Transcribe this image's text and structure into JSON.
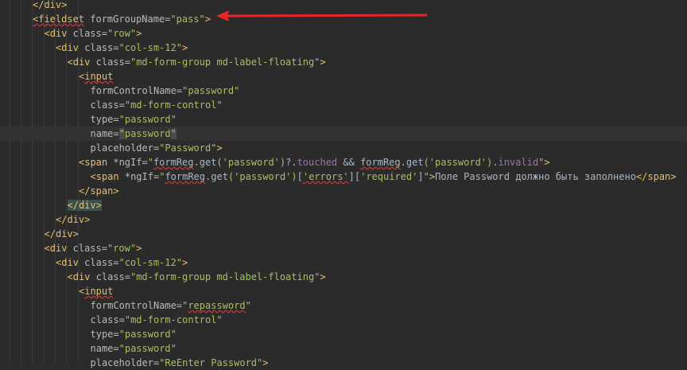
{
  "lines": [
    {
      "indent": 2,
      "tokens": [
        {
          "t": "</div>",
          "c": "tag"
        }
      ]
    },
    {
      "indent": 2,
      "tokens": [
        {
          "t": "<fieldset",
          "c": "tag",
          "sq": true
        },
        {
          "t": " formGroupName=",
          "c": "attr"
        },
        {
          "t": "\"pass\"",
          "c": "str"
        },
        {
          "t": ">",
          "c": "tag"
        }
      ]
    },
    {
      "indent": 3,
      "tokens": [
        {
          "t": "<div",
          "c": "tag"
        },
        {
          "t": " class=",
          "c": "attr"
        },
        {
          "t": "\"row\"",
          "c": "str"
        },
        {
          "t": ">",
          "c": "tag"
        }
      ]
    },
    {
      "indent": 4,
      "tokens": [
        {
          "t": "<div",
          "c": "tag"
        },
        {
          "t": " class=",
          "c": "attr"
        },
        {
          "t": "\"col-sm-12\"",
          "c": "str"
        },
        {
          "t": ">",
          "c": "tag"
        }
      ]
    },
    {
      "indent": 5,
      "tokens": [
        {
          "t": "<div",
          "c": "tag"
        },
        {
          "t": " class=",
          "c": "attr"
        },
        {
          "t": "\"md-form-group md-label-floating\"",
          "c": "str"
        },
        {
          "t": ">",
          "c": "tag"
        }
      ]
    },
    {
      "indent": 6,
      "tokens": [
        {
          "t": "<",
          "c": "tag"
        },
        {
          "t": "input",
          "c": "tag",
          "sq": true
        }
      ]
    },
    {
      "indent": 7,
      "tokens": [
        {
          "t": "formControlName=",
          "c": "attr"
        },
        {
          "t": "\"password\"",
          "c": "str"
        }
      ]
    },
    {
      "indent": 7,
      "tokens": [
        {
          "t": "class=",
          "c": "attr"
        },
        {
          "t": "\"md-form-control\"",
          "c": "str"
        }
      ]
    },
    {
      "indent": 7,
      "tokens": [
        {
          "t": "type=",
          "c": "attr"
        },
        {
          "t": "\"password\"",
          "c": "str"
        }
      ]
    },
    {
      "indent": 7,
      "current": true,
      "tokens": [
        {
          "t": "name=",
          "c": "attr"
        },
        {
          "t": "\"",
          "c": "str",
          "hl": "quote"
        },
        {
          "t": "password",
          "c": "str"
        },
        {
          "t": "\"",
          "c": "str",
          "hl": "quote"
        }
      ]
    },
    {
      "indent": 7,
      "tokens": [
        {
          "t": "placeholder=",
          "c": "attr"
        },
        {
          "t": "\"Password\"",
          "c": "str"
        },
        {
          "t": ">",
          "c": "tag"
        }
      ]
    },
    {
      "indent": 6,
      "tokens": [
        {
          "t": "<span",
          "c": "tag"
        },
        {
          "t": " *ngIf=",
          "c": "attr"
        },
        {
          "t": "\"",
          "c": "str"
        },
        {
          "t": "formReg",
          "c": "call",
          "sq": true
        },
        {
          "t": ".get",
          "c": "call"
        },
        {
          "t": "('password')",
          "c": "str"
        },
        {
          "t": "?.",
          "c": "call"
        },
        {
          "t": "touched",
          "c": "ident"
        },
        {
          "t": " && ",
          "c": "call"
        },
        {
          "t": "formReg",
          "c": "call",
          "sq": true
        },
        {
          "t": ".get",
          "c": "call"
        },
        {
          "t": "('password')",
          "c": "str"
        },
        {
          "t": ".",
          "c": "call"
        },
        {
          "t": "invalid",
          "c": "ident"
        },
        {
          "t": "\"",
          "c": "str"
        },
        {
          "t": ">",
          "c": "tag"
        }
      ]
    },
    {
      "indent": 7,
      "tokens": [
        {
          "t": "<span",
          "c": "tag"
        },
        {
          "t": " *ngIf=",
          "c": "attr"
        },
        {
          "t": "\"",
          "c": "str"
        },
        {
          "t": "formReg",
          "c": "call",
          "sq": true
        },
        {
          "t": ".get",
          "c": "call"
        },
        {
          "t": "('password')",
          "c": "str"
        },
        {
          "t": "[",
          "c": "call"
        },
        {
          "t": "'errors'",
          "c": "str",
          "sq": true
        },
        {
          "t": "][",
          "c": "call"
        },
        {
          "t": "'required'",
          "c": "str"
        },
        {
          "t": "]",
          "c": "call"
        },
        {
          "t": "\"",
          "c": "str"
        },
        {
          "t": ">",
          "c": "tag"
        },
        {
          "t": "Поле Password должно быть заполнено",
          "c": "text"
        },
        {
          "t": "</span>",
          "c": "tag"
        }
      ]
    },
    {
      "indent": 6,
      "tokens": [
        {
          "t": "</span>",
          "c": "tag"
        }
      ]
    },
    {
      "indent": 5,
      "tokens": [
        {
          "t": "</div>",
          "c": "tag",
          "hl": "tag"
        }
      ]
    },
    {
      "indent": 4,
      "tokens": [
        {
          "t": "</div>",
          "c": "tag"
        }
      ]
    },
    {
      "indent": 3,
      "tokens": [
        {
          "t": "</div>",
          "c": "tag"
        }
      ]
    },
    {
      "indent": 3,
      "tokens": [
        {
          "t": "<div",
          "c": "tag"
        },
        {
          "t": " class=",
          "c": "attr"
        },
        {
          "t": "\"row\"",
          "c": "str"
        },
        {
          "t": ">",
          "c": "tag"
        }
      ]
    },
    {
      "indent": 4,
      "tokens": [
        {
          "t": "<div",
          "c": "tag"
        },
        {
          "t": " class=",
          "c": "attr"
        },
        {
          "t": "\"col-sm-12\"",
          "c": "str"
        },
        {
          "t": ">",
          "c": "tag"
        }
      ]
    },
    {
      "indent": 5,
      "tokens": [
        {
          "t": "<div",
          "c": "tag"
        },
        {
          "t": " class=",
          "c": "attr"
        },
        {
          "t": "\"md-form-group md-label-floating\"",
          "c": "str"
        },
        {
          "t": ">",
          "c": "tag"
        }
      ]
    },
    {
      "indent": 6,
      "tokens": [
        {
          "t": "<",
          "c": "tag"
        },
        {
          "t": "input",
          "c": "tag",
          "sq": true
        }
      ]
    },
    {
      "indent": 7,
      "tokens": [
        {
          "t": "formControlName=",
          "c": "attr"
        },
        {
          "t": "\"",
          "c": "str"
        },
        {
          "t": "repassword",
          "c": "str",
          "sq": true
        },
        {
          "t": "\"",
          "c": "str"
        }
      ]
    },
    {
      "indent": 7,
      "tokens": [
        {
          "t": "class=",
          "c": "attr"
        },
        {
          "t": "\"md-form-control\"",
          "c": "str"
        }
      ]
    },
    {
      "indent": 7,
      "tokens": [
        {
          "t": "type=",
          "c": "attr"
        },
        {
          "t": "\"password\"",
          "c": "str"
        }
      ]
    },
    {
      "indent": 7,
      "tokens": [
        {
          "t": "name=",
          "c": "attr"
        },
        {
          "t": "\"password\"",
          "c": "str"
        }
      ]
    },
    {
      "indent": 7,
      "tokens": [
        {
          "t": "placeholder=",
          "c": "attr"
        },
        {
          "t": "\"ReEnter Password\"",
          "c": "str"
        },
        {
          "t": ">",
          "c": "tag"
        }
      ]
    }
  ],
  "colors": {
    "background": "#2b2b2b",
    "current_line": "#323232",
    "tag": "#e8bf6a",
    "attribute": "#bababa",
    "string": "#a5c25c",
    "identifier": "#9876aa",
    "text": "#a9b7c6",
    "annotation_arrow": "#e8262a"
  },
  "annotation": {
    "type": "arrow",
    "points_to": "fieldset line",
    "icon": "red-arrow-icon"
  }
}
